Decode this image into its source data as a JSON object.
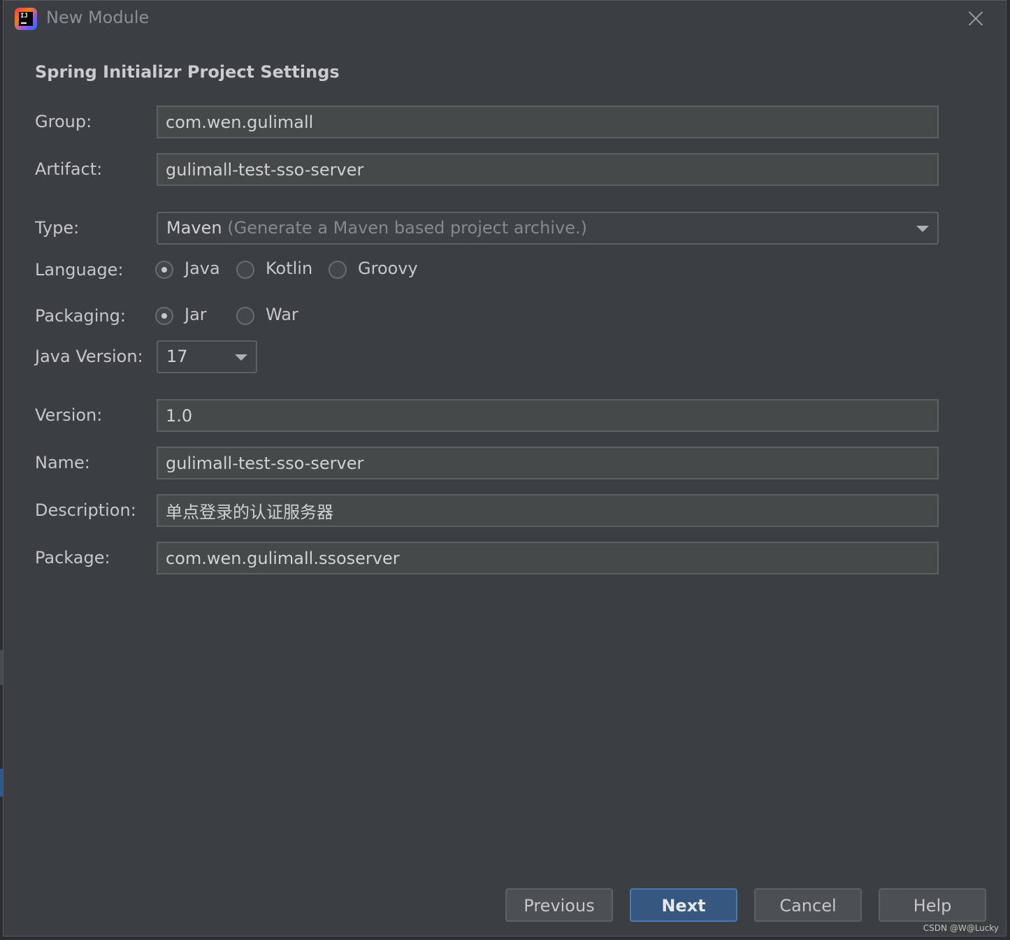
{
  "window": {
    "title": "New Module",
    "icon": "intellij-idea-icon"
  },
  "section_title": "Spring Initializr Project Settings",
  "fields": {
    "group": {
      "label": "Group:",
      "value": "com.wen.gulimall"
    },
    "artifact": {
      "label": "Artifact:",
      "value": "gulimall-test-sso-server"
    },
    "type": {
      "label": "Type:",
      "value": "Maven",
      "hint": "(Generate a Maven based project archive.)"
    },
    "language": {
      "label": "Language:",
      "options": [
        "Java",
        "Kotlin",
        "Groovy"
      ],
      "selected": "Java"
    },
    "packaging": {
      "label": "Packaging:",
      "options": [
        "Jar",
        "War"
      ],
      "selected": "Jar"
    },
    "java_version": {
      "label": "Java Version:",
      "value": "17"
    },
    "version": {
      "label": "Version:",
      "value": "1.0"
    },
    "name": {
      "label": "Name:",
      "value": "gulimall-test-sso-server"
    },
    "description": {
      "label": "Description:",
      "value": "单点登录的认证服务器"
    },
    "package": {
      "label": "Package:",
      "value": "com.wen.gulimall.ssoserver"
    }
  },
  "buttons": {
    "previous": "Previous",
    "next": "Next",
    "cancel": "Cancel",
    "help": "Help"
  },
  "watermark": "CSDN @W@Lucky",
  "colors": {
    "background": "#3c3f41",
    "primary_button": "#365880",
    "field_bg": "#45494a"
  }
}
